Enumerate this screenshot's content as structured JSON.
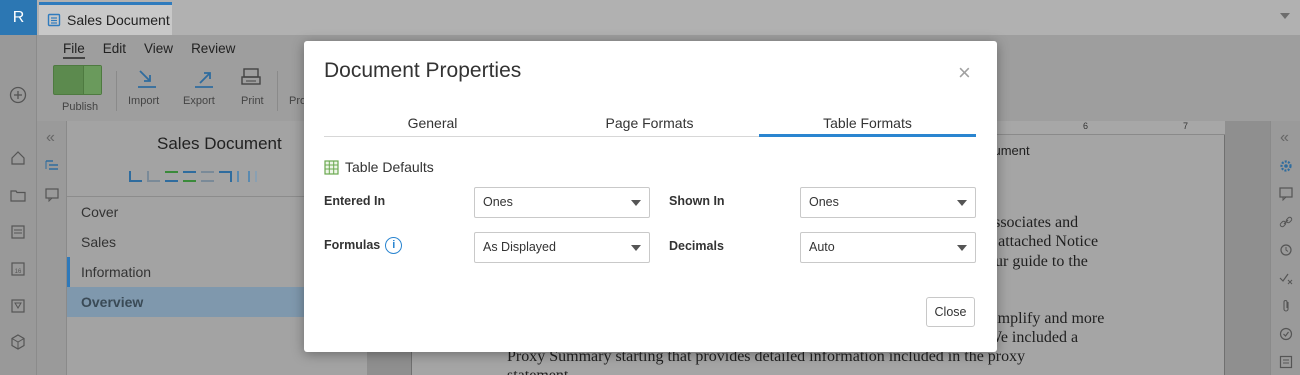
{
  "app": {
    "logo_letter": "R",
    "doc_tab": "Sales Document"
  },
  "menu": [
    "File",
    "Edit",
    "View",
    "Review"
  ],
  "ribbon": {
    "publish": "Publish",
    "import": "Import",
    "export": "Export",
    "print": "Print",
    "truncated": "Pro"
  },
  "outline": {
    "title": "Sales Document",
    "items": [
      "Cover",
      "Sales",
      "Information",
      "Overview"
    ]
  },
  "ruler": {
    "n6": "6",
    "n7": "7"
  },
  "page_text": {
    "l0": "cument",
    "l1": "associates and",
    "l2": "e attached Notice",
    "l3": "our guide to the",
    "l4": "simplify and more",
    "l5": "We included a",
    "l6": "Proxy Summary starting that provides detailed information included in the proxy",
    "l7": "statement"
  },
  "modal": {
    "title": "Document Properties",
    "close_symbol": "×",
    "tabs": [
      "General",
      "Page Formats",
      "Table Formats"
    ],
    "section": "Table Defaults",
    "fields": {
      "entered_in": {
        "label": "Entered In",
        "value": "Ones"
      },
      "shown_in": {
        "label": "Shown In",
        "value": "Ones"
      },
      "formulas": {
        "label": "Formulas",
        "value": "As Displayed",
        "info": "i"
      },
      "decimals": {
        "label": "Decimals",
        "value": "Auto"
      }
    },
    "close_button": "Close"
  },
  "colors": {
    "accent": "#2a85d0",
    "brand": "#2c77b3",
    "publish": "#5c8a4e"
  }
}
